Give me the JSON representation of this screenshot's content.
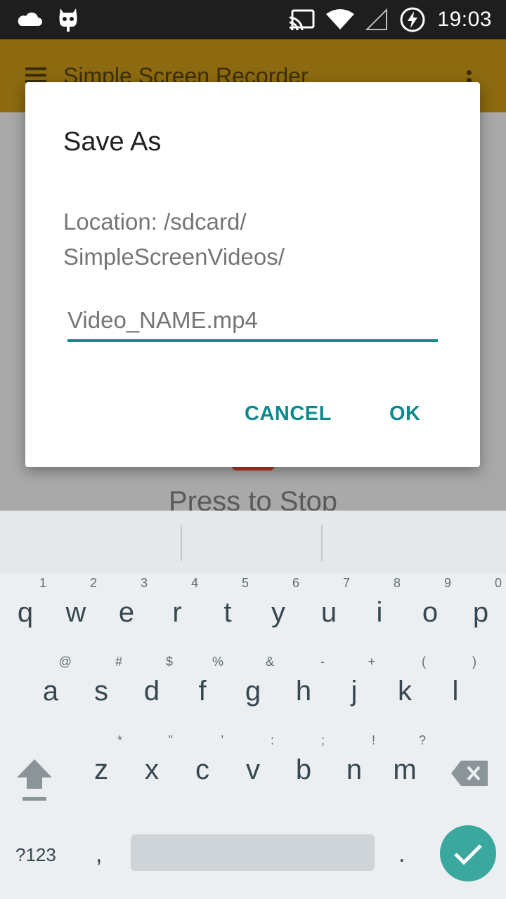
{
  "status_bar": {
    "time": "19:03",
    "icons": [
      "cloud-icon",
      "cyanogen-icon",
      "cast-icon",
      "wifi-icon",
      "signal-icon",
      "battery-charging-icon"
    ]
  },
  "app_bar": {
    "title": "Simple Screen Recorder",
    "background": "#ff9800"
  },
  "background": {
    "press_text": "Press to Stop"
  },
  "dialog": {
    "title": "Save As",
    "message": "Location: /sdcard/ SimpleScreenVideos/",
    "input_placeholder": "Video_NAME.mp4",
    "cancel_label": "CANCEL",
    "ok_label": "OK",
    "accent": "#0e8a8c"
  },
  "keyboard": {
    "rows": [
      [
        {
          "key": "q",
          "hint": "1"
        },
        {
          "key": "w",
          "hint": "2"
        },
        {
          "key": "e",
          "hint": "3"
        },
        {
          "key": "r",
          "hint": "4"
        },
        {
          "key": "t",
          "hint": "5"
        },
        {
          "key": "y",
          "hint": "6"
        },
        {
          "key": "u",
          "hint": "7"
        },
        {
          "key": "i",
          "hint": "8"
        },
        {
          "key": "o",
          "hint": "9"
        },
        {
          "key": "p",
          "hint": "0"
        }
      ],
      [
        {
          "key": "a",
          "hint": "@"
        },
        {
          "key": "s",
          "hint": "#"
        },
        {
          "key": "d",
          "hint": "$"
        },
        {
          "key": "f",
          "hint": "%"
        },
        {
          "key": "g",
          "hint": "&"
        },
        {
          "key": "h",
          "hint": "-"
        },
        {
          "key": "j",
          "hint": "+"
        },
        {
          "key": "k",
          "hint": "("
        },
        {
          "key": "l",
          "hint": ")"
        }
      ],
      [
        {
          "key": "z",
          "hint": "*"
        },
        {
          "key": "x",
          "hint": "\""
        },
        {
          "key": "c",
          "hint": "'"
        },
        {
          "key": "v",
          "hint": ":"
        },
        {
          "key": "b",
          "hint": ";"
        },
        {
          "key": "n",
          "hint": "!"
        },
        {
          "key": "m",
          "hint": "?"
        }
      ]
    ],
    "symbols_label": "?123",
    "comma": ",",
    "period": ".",
    "enter_color": "#3aa89f"
  }
}
